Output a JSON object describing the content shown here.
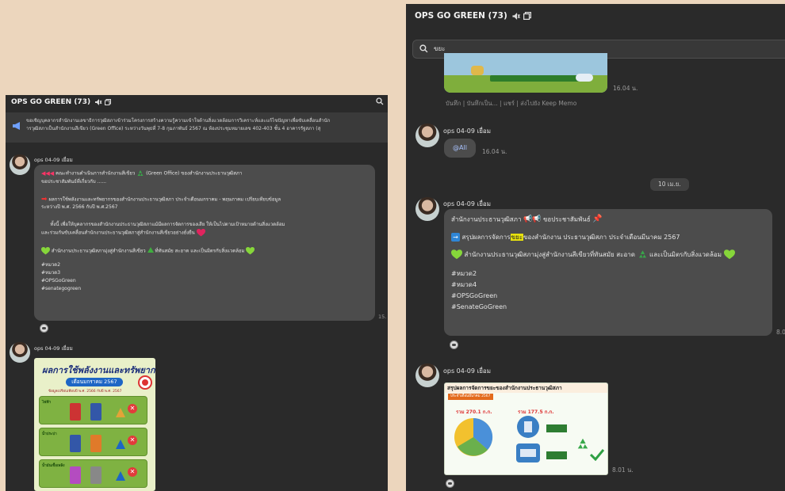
{
  "left_window": {
    "title": "OPS GO GREEN (73)",
    "pinned": {
      "line1": "ขอเชิญบุคลากรสำนักงานเลขาธิการวุฒิสภาเข้าร่วมโครงการสร้างความรู้ความเข้าใจด้านสิ่งแวดล้อมการวิเคราะห์และแก้ไขปัญหาเพื่อขับเคลื่อนสำนัก",
      "line2": "ารวุฒิสภาเป็นสำนักงานสีเขียว (Green Office) ระหว่างวันพุธที่ 7-8 กุมภาพันธ์ 2567 ณ ห้องประชุมหมายเลข 402-403 ชั้น 4 อาคารรัฐสภา (สุ"
    },
    "messages": [
      {
        "sender": "ops 04-09 เยื่อม",
        "lines": [
          "คณะทำงานดำเนินการสำนักงานสีเขียว",
          "(Green Office) ของสำนักงานประธานวุฒิสภา",
          "ขอประชาสัมพันธ์ที่เกี่ยวกับ ......",
          "ผลการใช้พลังงานและทรัพยากรของสำนักงานประธานวุฒิสภา ประจำเดือนมกราคม - พฤษภาคม เปรียบเทียบข้อมูล",
          "ระหว่างปี พ.ศ. 2566 กับปี พ.ศ.2567",
          "ทั้งนี้ เพื่อให้บุคลากรของสำนักงานประธานวุฒิสภาแม้มีผลการจัดการของเสีย ให้เป็นไปตามเป้าหมายด้านสิ่งแวดล้อม",
          "และร่วมกันขับเคลื่อนสำนักงานประธานวุฒิสภาสู่สำนักงานสีเขียวอย่างยั่งยืน",
          "สำนักงานประธานวุฒิสภามุ่งสู่สำนักงานสีเขียว",
          "ที่ทันสมัย สะอาด และเป็นมิตรกับสิ่งแวดล้อม",
          "#หมวด2",
          "#หมวด3",
          "#OPSGoGreen",
          "#senategogreen"
        ],
        "time": "15."
      },
      {
        "sender": "ops 04-09 เยื่อม"
      }
    ],
    "poster": {
      "title": "ผลการใช้พลังงานและทรัพยากร",
      "month": "เดือนมกราคม 2567",
      "subtitle": "ข้อมูลเปรียบเทียบปี พ.ศ. 2566 กับปี พ.ศ. 2567",
      "rows": [
        "ไฟฟ้า",
        "น้ำประปา",
        "น้ำมันเชื้อเพลิง"
      ]
    }
  },
  "right_window": {
    "title": "OPS GO GREEN (73)",
    "search_value": "ขยะ",
    "top_time": "16.04 น.",
    "links": "บันทึก | บันทึกเป็น... | แชร์ | ส่งไปยัง Keep Memo",
    "msg_all": {
      "sender": "ops 04-09 เยื่อม",
      "mention": "@All",
      "time": "16.04 น."
    },
    "date_chip": "10 เม.ย.",
    "msg_main": {
      "sender": "ops 04-09 เยื่อม",
      "line1": "สำนักงานประธานวุฒิสภา",
      "line1_b": "ขอประชาสัมพันธ์",
      "line2_a": "สรุปผลการจัดการ",
      "line2_hl": "ขยะ",
      "line2_b": "ของสำนักงาน ประธานวุฒิสภา ประจำเดือนมีนาคม 2567",
      "line3_a": "สำนักงานประธานวุฒิสภามุ่งสู่สำนักงานสีเขียวที่ทันสมัย สะอาด",
      "line3_b": "และเป็นมิตรกับสิ่งแวดล้อม",
      "tags": [
        "#หมวด2",
        "#หมวด4",
        "#OPSGoGreen",
        "#SenateGoGreen"
      ],
      "time": "8.0"
    },
    "msg_poster": {
      "sender": "ops 04-09 เยื่อม",
      "head": "สรุปผลการจัดการขยะของสำนักงานประธานวุฒิสภา",
      "tag": "ประจำเดือนมีนาคม 2567",
      "total1": "รวม 270.1 ก.ก.",
      "total2": "รวม 177.5 ก.ก.",
      "time": "8.01 น."
    }
  },
  "colors": {
    "bg": "#ecd6bd",
    "window": "#2a2a2a",
    "bubble": "#4c4c4c",
    "highlight": "#e8e20e"
  }
}
